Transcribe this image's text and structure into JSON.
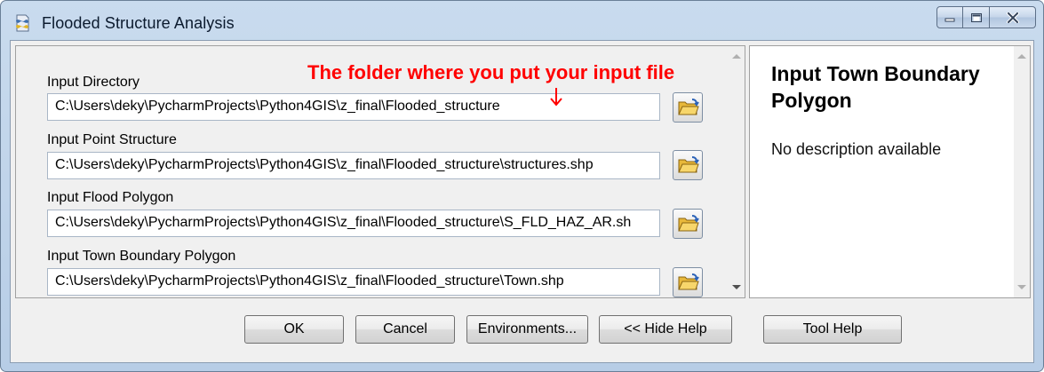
{
  "window": {
    "title": "Flooded Structure Analysis",
    "icon": "python-script-icon"
  },
  "fields": [
    {
      "label": "Input Directory",
      "value": "C:\\Users\\deky\\PycharmProjects\\Python4GIS\\z_final\\Flooded_structure"
    },
    {
      "label": "Input Point Structure",
      "value": "C:\\Users\\deky\\PycharmProjects\\Python4GIS\\z_final\\Flooded_structure\\structures.shp"
    },
    {
      "label": "Input Flood Polygon",
      "value": "C:\\Users\\deky\\PycharmProjects\\Python4GIS\\z_final\\Flooded_structure\\S_FLD_HAZ_AR.sh"
    },
    {
      "label": "Input Town Boundary Polygon",
      "value": "C:\\Users\\deky\\PycharmProjects\\Python4GIS\\z_final\\Flooded_structure\\Town.shp"
    }
  ],
  "annotation": {
    "text": "The folder where you put your input file",
    "color": "#ff0000"
  },
  "help": {
    "title": "Input Town Boundary Polygon",
    "description": "No description available"
  },
  "buttons": {
    "ok": "OK",
    "cancel": "Cancel",
    "environments": "Environments...",
    "hide_help": "<< Hide Help",
    "tool_help": "Tool Help"
  }
}
